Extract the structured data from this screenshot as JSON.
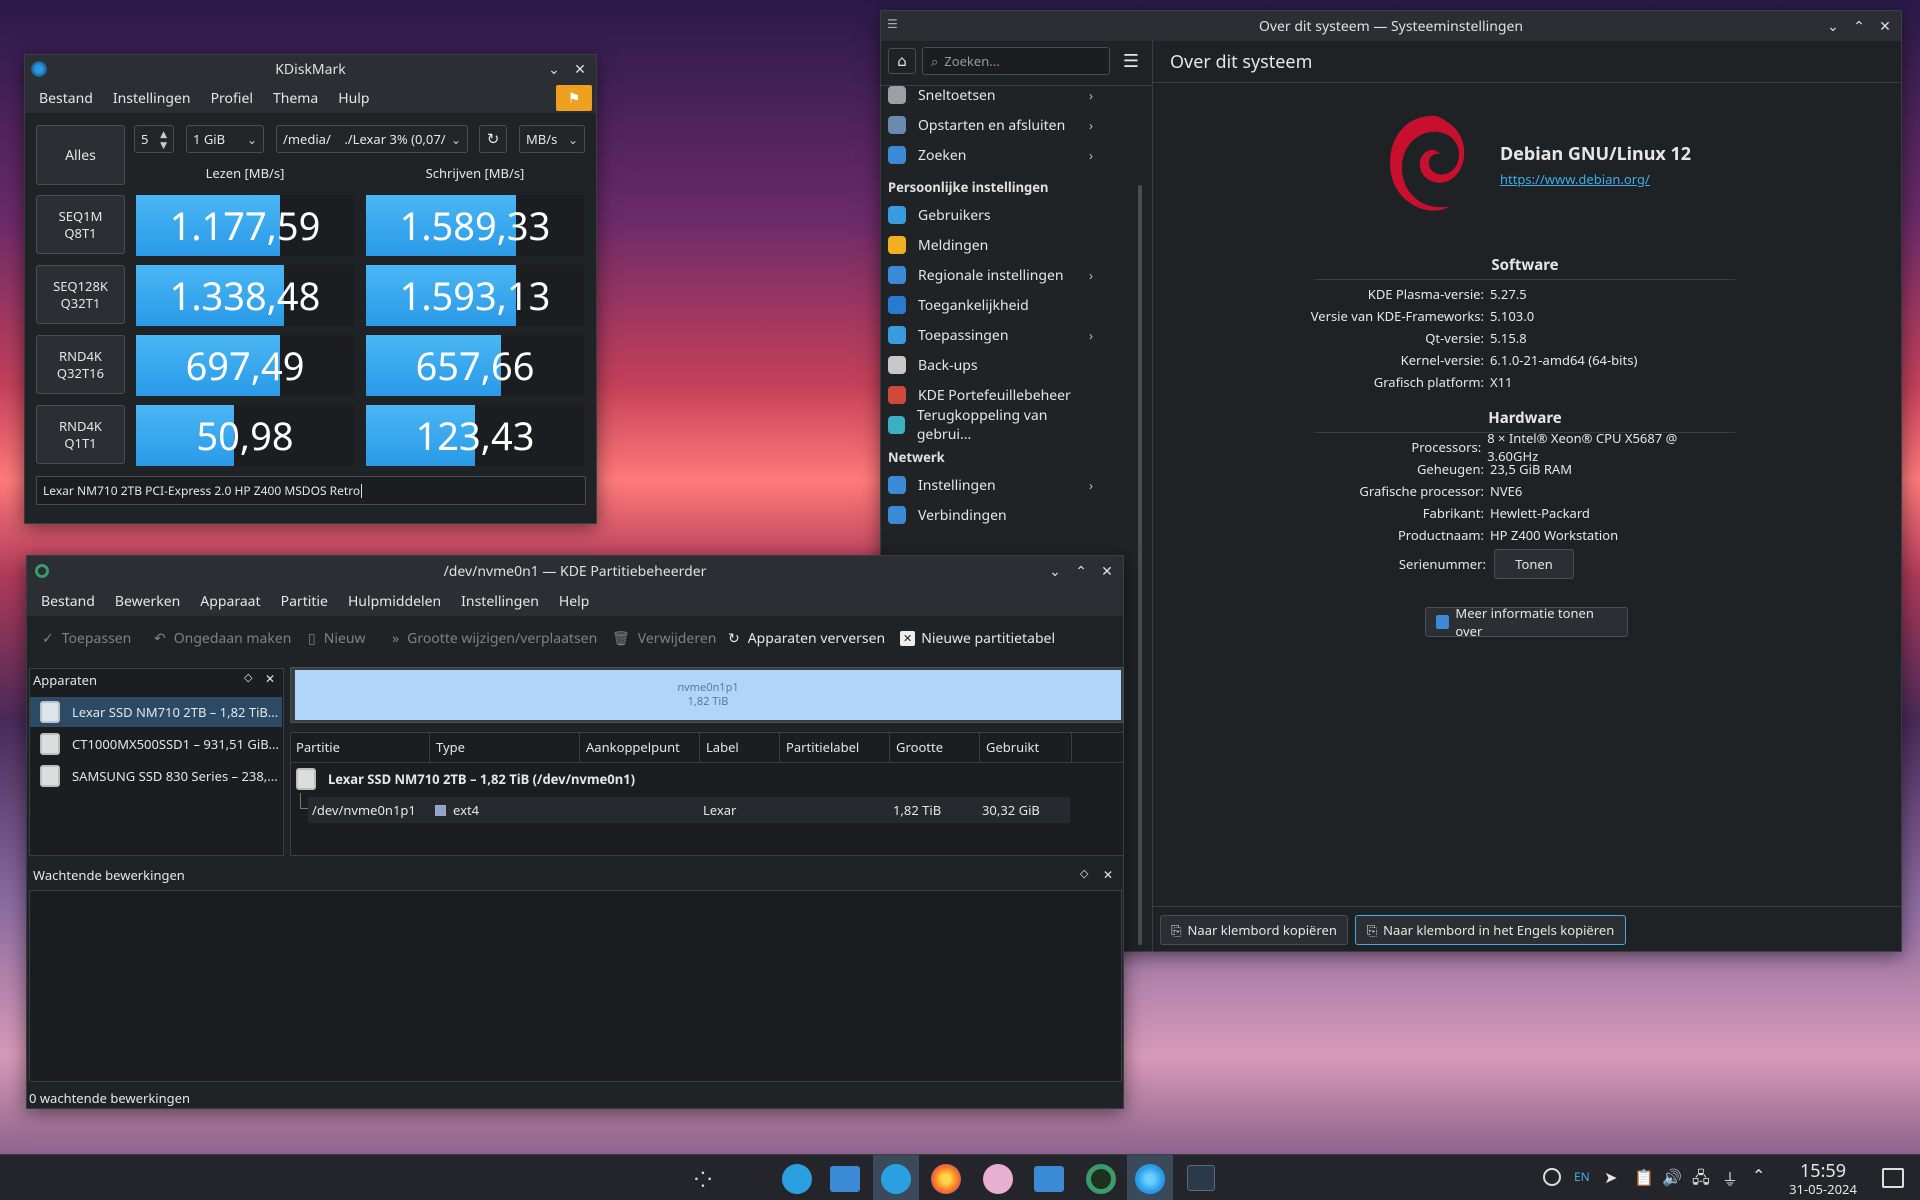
{
  "kdiskmark": {
    "title": "KDiskMark",
    "menu": [
      "Bestand",
      "Instellingen",
      "Profiel",
      "Thema",
      "Hulp"
    ],
    "all_button": "Alles",
    "runs": "5",
    "size": "1 GiB",
    "path": "/media/    ./Lexar 3% (0,07/",
    "unit": "MB/s",
    "read_header": "Lezen [MB/s]",
    "write_header": "Schrijven [MB/s]",
    "tests": [
      {
        "label": "SEQ1M\nQ8T1",
        "read": "1.177,59",
        "write": "1.589,33"
      },
      {
        "label": "SEQ128K\nQ32T1",
        "read": "1.338,48",
        "write": "1.593,13"
      },
      {
        "label": "RND4K\nQ32T16",
        "read": "697,49",
        "write": "657,66"
      },
      {
        "label": "RND4K\nQ1T1",
        "read": "50,98",
        "write": "123,43"
      }
    ],
    "bar_fill": {
      "read": [
        0.66,
        0.68,
        0.66,
        0.45
      ],
      "write": [
        0.69,
        0.69,
        0.62,
        0.5
      ]
    },
    "comment": "Lexar NM710 2TB PCI-Express 2.0 HP Z400 MSDOS Retro"
  },
  "sysinfo": {
    "title": "Over dit systeem — Systeeminstellingen",
    "search_placeholder": "Zoeken...",
    "page_title": "Over dit systeem",
    "sidebar": {
      "items_top": [
        {
          "label": "Sneltoetsen",
          "chevron": true,
          "color": "#9aa0a6"
        },
        {
          "label": "Opstarten en afsluiten",
          "chevron": true,
          "color": "#6a8ab0"
        },
        {
          "label": "Zoeken",
          "chevron": true,
          "color": "#3a8ad6"
        }
      ],
      "section_personal": "Persoonlijke instellingen",
      "items_personal": [
        {
          "label": "Gebruikers",
          "chevron": false,
          "color": "#3a9ae0"
        },
        {
          "label": "Meldingen",
          "chevron": false,
          "color": "#f0b020"
        },
        {
          "label": "Regionale instellingen",
          "chevron": true,
          "color": "#3a8ad6"
        },
        {
          "label": "Toegankelijkheid",
          "chevron": false,
          "color": "#2a7ad0"
        },
        {
          "label": "Toepassingen",
          "chevron": true,
          "color": "#3a9ae0"
        },
        {
          "label": "Back-ups",
          "chevron": false,
          "color": "#c8c8c8"
        },
        {
          "label": "KDE Portefeuillebeheer",
          "chevron": false,
          "color": "#d04a3a"
        },
        {
          "label": "Terugkoppeling van gebrui...",
          "chevron": false,
          "color": "#3ab0c0"
        }
      ],
      "section_network": "Netwerk",
      "items_network": [
        {
          "label": "Instellingen",
          "chevron": true,
          "color": "#3a8ad6"
        },
        {
          "label": "Verbindingen",
          "chevron": false,
          "color": "#3a8ad6"
        }
      ]
    },
    "distro_name": "Debian GNU/Linux 12",
    "distro_url": "https://www.debian.org/",
    "software_title": "Software",
    "software": [
      {
        "k": "KDE Plasma-versie:",
        "v": "5.27.5"
      },
      {
        "k": "Versie van KDE-Frameworks:",
        "v": "5.103.0"
      },
      {
        "k": "Qt-versie:",
        "v": "5.15.8"
      },
      {
        "k": "Kernel-versie:",
        "v": "6.1.0-21-amd64 (64-bits)"
      },
      {
        "k": "Grafisch platform:",
        "v": "X11"
      }
    ],
    "hardware_title": "Hardware",
    "hardware": [
      {
        "k": "Processors:",
        "v": "8 × Intel® Xeon® CPU X5687 @ 3.60GHz"
      },
      {
        "k": "Geheugen:",
        "v": "23,5 GiB RAM"
      },
      {
        "k": "Grafische processor:",
        "v": "NVE6"
      },
      {
        "k": "Fabrikant:",
        "v": "Hewlett-Packard"
      },
      {
        "k": "Productnaam:",
        "v": "HP Z400 Workstation"
      }
    ],
    "serial_label": "Serienummer:",
    "serial_button": "Tonen",
    "more_info_button": "Meer informatie tonen over",
    "copy_button": "Naar klembord kopiëren",
    "copy_en_button": "Naar klembord in het Engels kopiëren"
  },
  "partman": {
    "title": "/dev/nvme0n1 — KDE Partitiebeheerder",
    "menu": [
      "Bestand",
      "Bewerken",
      "Apparaat",
      "Partitie",
      "Hulpmiddelen",
      "Instellingen",
      "Help"
    ],
    "toolbar": {
      "apply": "Toepassen",
      "undo": "Ongedaan maken",
      "new": "Nieuw",
      "resize": "Grootte wijzigen/verplaatsen",
      "delete": "Verwijderen",
      "refresh": "Apparaten verversen",
      "new_table": "Nieuwe partitietabel"
    },
    "devices_title": "Apparaten",
    "devices": [
      "Lexar SSD NM710 2TB – 1,82 TiB...",
      "CT1000MX500SSD1 – 931,51 GiB...",
      "SAMSUNG SSD 830 Series – 238,..."
    ],
    "graph_name": "nvme0n1p1",
    "graph_size": "1,82 TiB",
    "columns": [
      "Partitie",
      "Type",
      "Aankoppelpunt",
      "Label",
      "Partitielabel",
      "Grootte",
      "Gebruikt"
    ],
    "disk_row": "Lexar SSD NM710 2TB – 1,82 TiB (/dev/nvme0n1)",
    "partition": {
      "name": "/dev/nvme0n1p1",
      "type": "ext4",
      "mount": "",
      "label": "Lexar",
      "plabel": "",
      "size": "1,82 TiB",
      "used": "30,32 GiB"
    },
    "pending_title": "Wachtende bewerkingen",
    "status": "0 wachtende bewerkingen"
  },
  "taskbar": {
    "lang": "EN",
    "time": "15:59",
    "date": "31-05-2024"
  }
}
